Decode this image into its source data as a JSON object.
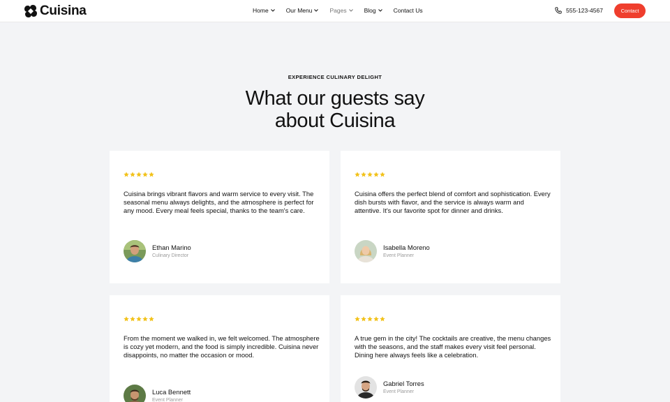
{
  "header": {
    "brand": "Cuisina",
    "nav": [
      {
        "label": "Home",
        "has_menu": true
      },
      {
        "label": "Our Menu",
        "has_menu": true
      },
      {
        "label": "Pages",
        "has_menu": true
      },
      {
        "label": "Blog",
        "has_menu": true
      },
      {
        "label": "Contact Us",
        "has_menu": false
      }
    ],
    "phone": "555-123-4567",
    "contact_label": "Contact",
    "accent_color": "#ef3e2d"
  },
  "section": {
    "eyebrow": "EXPERIENCE CULINARY DELIGHT",
    "title_line1": "What our guests say",
    "title_line2": "about Cuisina"
  },
  "star_color": "#f2c21b",
  "testimonials": [
    {
      "rating": 5,
      "text": "Cuisina brings vibrant flavors and warm service to every visit. The seasonal menu always delights, and the atmosphere is perfect for any mood. Every meal feels special, thanks to the team's care.",
      "name": "Ethan Marino",
      "role": "Culinary Director"
    },
    {
      "rating": 5,
      "text": "Cuisina offers the perfect blend of comfort and sophistication. Every dish bursts with flavor, and the service is always warm and attentive. It's our favorite spot for dinner and drinks.",
      "name": "Isabella Moreno",
      "role": "Event Planner"
    },
    {
      "rating": 5,
      "text": "From the moment we walked in, we felt welcomed. The atmosphere is cozy yet modern, and the food is simply incredible. Cuisina never disappoints, no matter the occasion or mood.",
      "name": "Luca Bennett",
      "role": "Event Planner"
    },
    {
      "rating": 5,
      "text": "A true gem in the city! The cocktails are creative, the menu changes with the seasons, and the staff makes every visit feel personal. Dining here always feels like a celebration.",
      "name": "Gabriel Torres",
      "role": "Event Planner"
    }
  ]
}
